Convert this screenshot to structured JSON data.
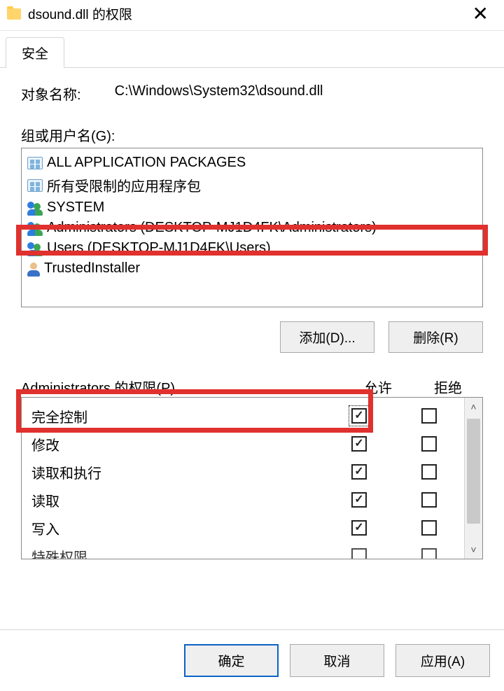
{
  "titlebar": {
    "title": "dsound.dll 的权限"
  },
  "tabs": {
    "security": "安全"
  },
  "object": {
    "label": "对象名称:",
    "path": "C:\\Windows\\System32\\dsound.dll"
  },
  "groups": {
    "label": "组或用户名(G):",
    "items": [
      {
        "name": "ALL APPLICATION PACKAGES",
        "icon": "pkg"
      },
      {
        "name": "所有受限制的应用程序包",
        "icon": "pkg"
      },
      {
        "name": "SYSTEM",
        "icon": "users"
      },
      {
        "name": "Administrators (DESKTOP-MJ1D4FK\\Administrators)",
        "icon": "users"
      },
      {
        "name": "Users (DESKTOP-MJ1D4FK\\Users)",
        "icon": "users"
      },
      {
        "name": "TrustedInstaller",
        "icon": "person"
      }
    ]
  },
  "buttons": {
    "add": "添加(D)...",
    "remove": "删除(R)"
  },
  "perms": {
    "label": "Administrators 的权限(P)",
    "allow": "允许",
    "deny": "拒绝",
    "rows": [
      {
        "name": "完全控制",
        "allow": true,
        "deny": false,
        "focus": true
      },
      {
        "name": "修改",
        "allow": true,
        "deny": false
      },
      {
        "name": "读取和执行",
        "allow": true,
        "deny": false
      },
      {
        "name": "读取",
        "allow": true,
        "deny": false
      },
      {
        "name": "写入",
        "allow": true,
        "deny": false
      },
      {
        "name": "特殊权限",
        "allow": false,
        "deny": false
      }
    ]
  },
  "footer": {
    "ok": "确定",
    "cancel": "取消",
    "apply": "应用(A)"
  }
}
